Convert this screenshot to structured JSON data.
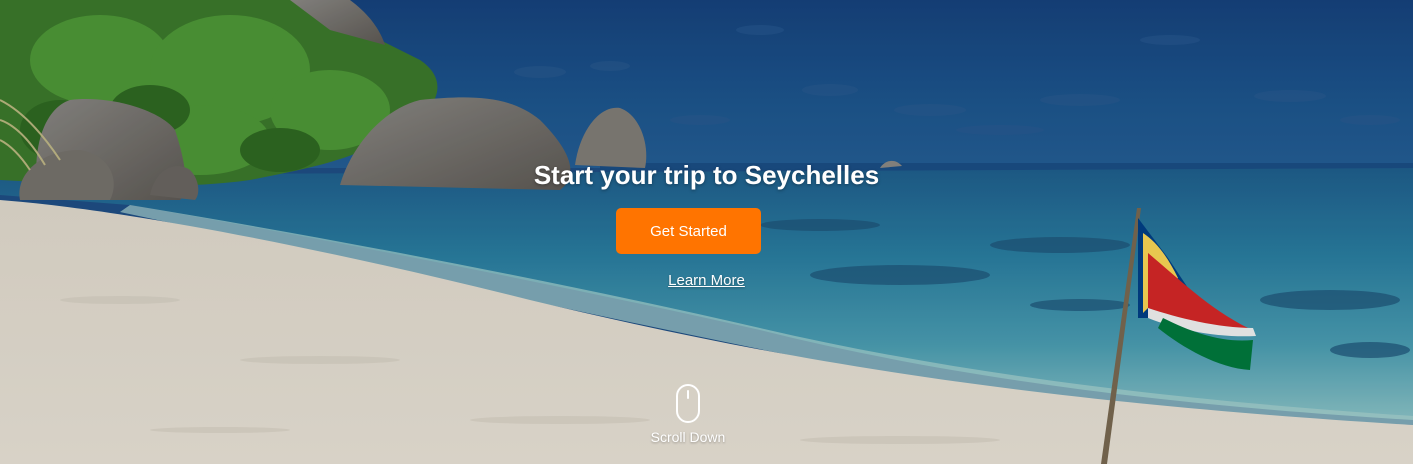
{
  "hero": {
    "title": "Start your trip to Seychelles",
    "primary_button_label": "Get Started",
    "secondary_link_label": "Learn More",
    "scroll_label": "Scroll Down",
    "background_icon": "seychelles-beach-photo"
  },
  "colors": {
    "accent": "#ff7400",
    "text": "#ffffff",
    "sky": "#1d4c86",
    "sea": "#2d8aa6",
    "sand": "#e9e2d6"
  }
}
